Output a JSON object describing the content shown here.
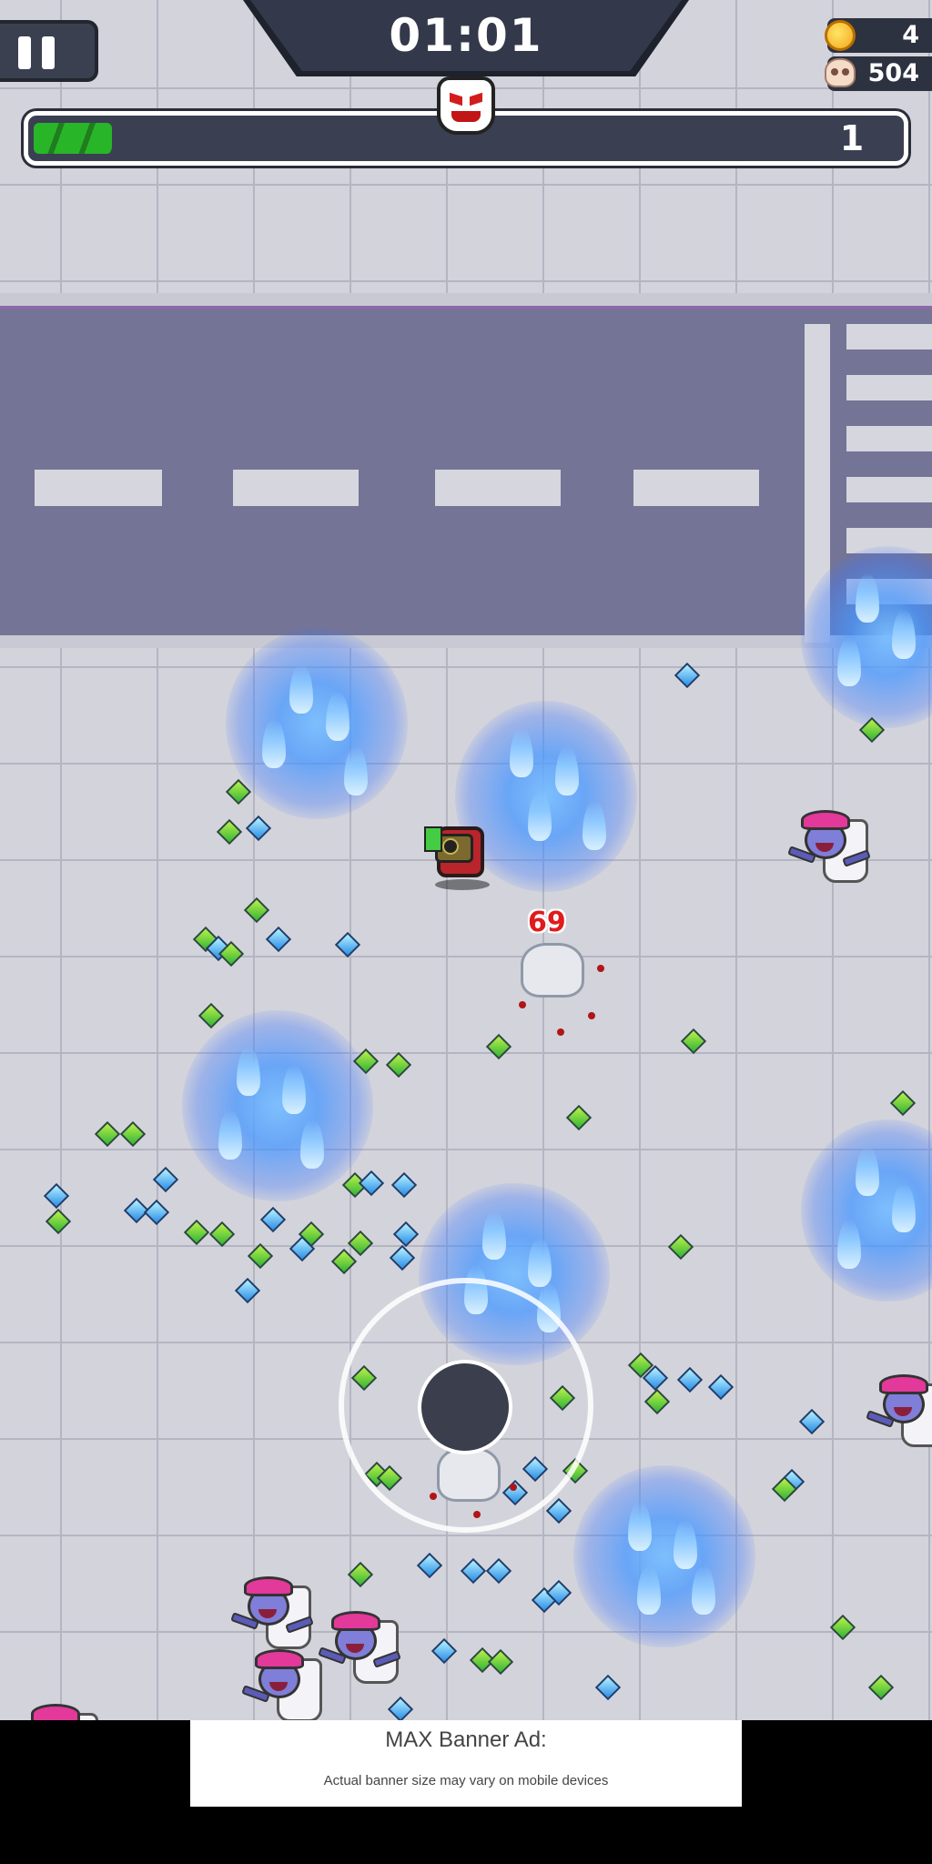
{
  "hud": {
    "timer": "01:01",
    "coins": "4",
    "kills": "504",
    "level": "1",
    "xp_progress": 0.09,
    "pause_icon": "pause-icon",
    "boss_icon": "boss-skull-icon",
    "coin_icon": "coin-icon",
    "kills_icon": "skull-icon"
  },
  "combat": {
    "damage_number": "69"
  },
  "colors": {
    "xp_fill": "#28b628",
    "fire": "#5aa8ff",
    "road": "#747496",
    "floor": "#d3d3dc",
    "damage": "#e01b1b"
  },
  "ad": {
    "title": "MAX Banner Ad:",
    "subtitle": "Actual banner size may vary on mobile devices"
  }
}
